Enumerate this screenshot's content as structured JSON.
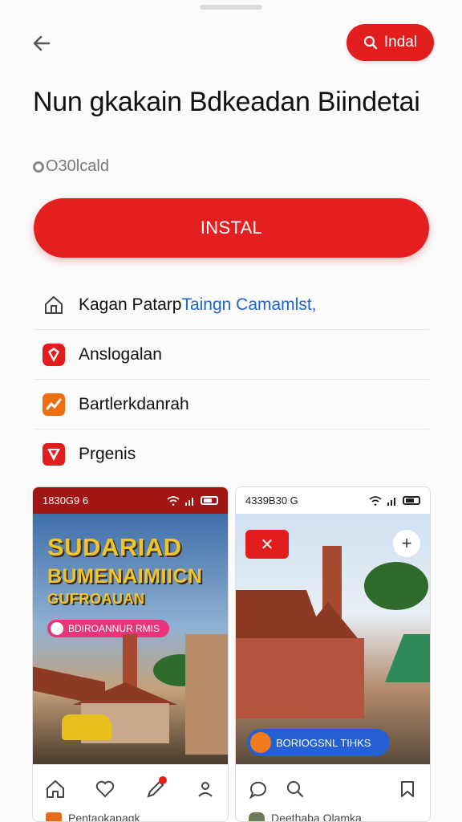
{
  "header": {
    "back_icon": "arrow-left-icon",
    "install_pill_label": "Indal",
    "install_pill_icon": "search-icon"
  },
  "app": {
    "title": "Nun gkakain Bdkeadan Biindetai",
    "sub_label": "O30lcald"
  },
  "primary_button": {
    "label": "INSTAL"
  },
  "menu": {
    "items": [
      {
        "icon": "home-outline-icon",
        "label": "Kagan Patarp",
        "label_extra": "Taingn Camamlst,"
      },
      {
        "icon": "red-gem-icon",
        "label": "Anslogalan"
      },
      {
        "icon": "orange-chart-icon",
        "label": "Bartlerkdanrah"
      },
      {
        "icon": "red-shield-icon",
        "label": "Prgenis"
      }
    ]
  },
  "screenshots": {
    "left": {
      "status_time": "1830G9 6",
      "headline_1": "SUDARIAD",
      "headline_2": "BUMENAIMIICN",
      "headline_3": "GUFROAUAN",
      "tag_label": "BDIROANNUR RMIS",
      "footer_text": "Pentaokapaqk"
    },
    "right": {
      "status_time": "4339B30 G",
      "badge_label": "✕",
      "plus_label": "+",
      "tag_label": "BORIOGSNL TIHKS",
      "footer_text": "Deethaba Olamka"
    }
  },
  "colors": {
    "accent_red": "#e11d1d",
    "link_blue": "#1d63d0",
    "dark_red_status": "#a11515"
  }
}
